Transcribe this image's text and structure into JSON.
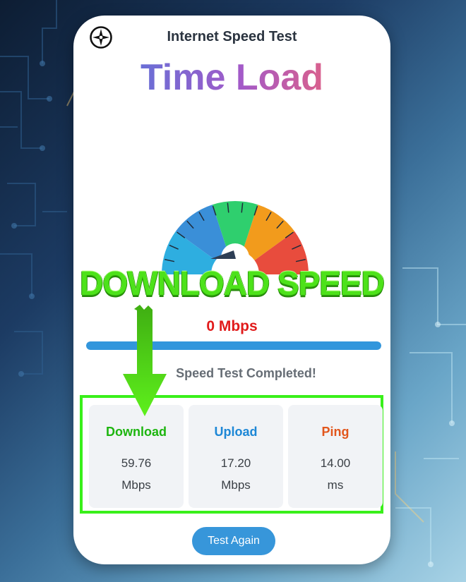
{
  "app": {
    "title": "Internet Speed Test",
    "brand": "Time Load"
  },
  "gauge": {
    "icon": "speedometer-icon",
    "segment_colors": [
      "#2eaee0",
      "#3a8fd8",
      "#2fcf6e",
      "#f29b1c",
      "#e84c3d"
    ]
  },
  "banner": {
    "text": "DOWNLOAD SPEED"
  },
  "current_speed": "0 Mbps",
  "progress": {
    "percent": 100
  },
  "status": "Speed Test Completed!",
  "results": [
    {
      "label": "Download",
      "value": "59.76",
      "unit": "Mbps",
      "color": "#1db50f"
    },
    {
      "label": "Upload",
      "value": "17.20",
      "unit": "Mbps",
      "color": "#1d87d6"
    },
    {
      "label": "Ping",
      "value": "14.00",
      "unit": "ms",
      "color": "#e2561c"
    }
  ],
  "actions": {
    "test_again": "Test Again"
  },
  "icons": {
    "top_left": "compass-icon",
    "annotation": "arrow-down-icon"
  },
  "colors": {
    "highlight_border": "#39f01a",
    "accent": "#3796da",
    "speed_red": "#e11b1b"
  }
}
